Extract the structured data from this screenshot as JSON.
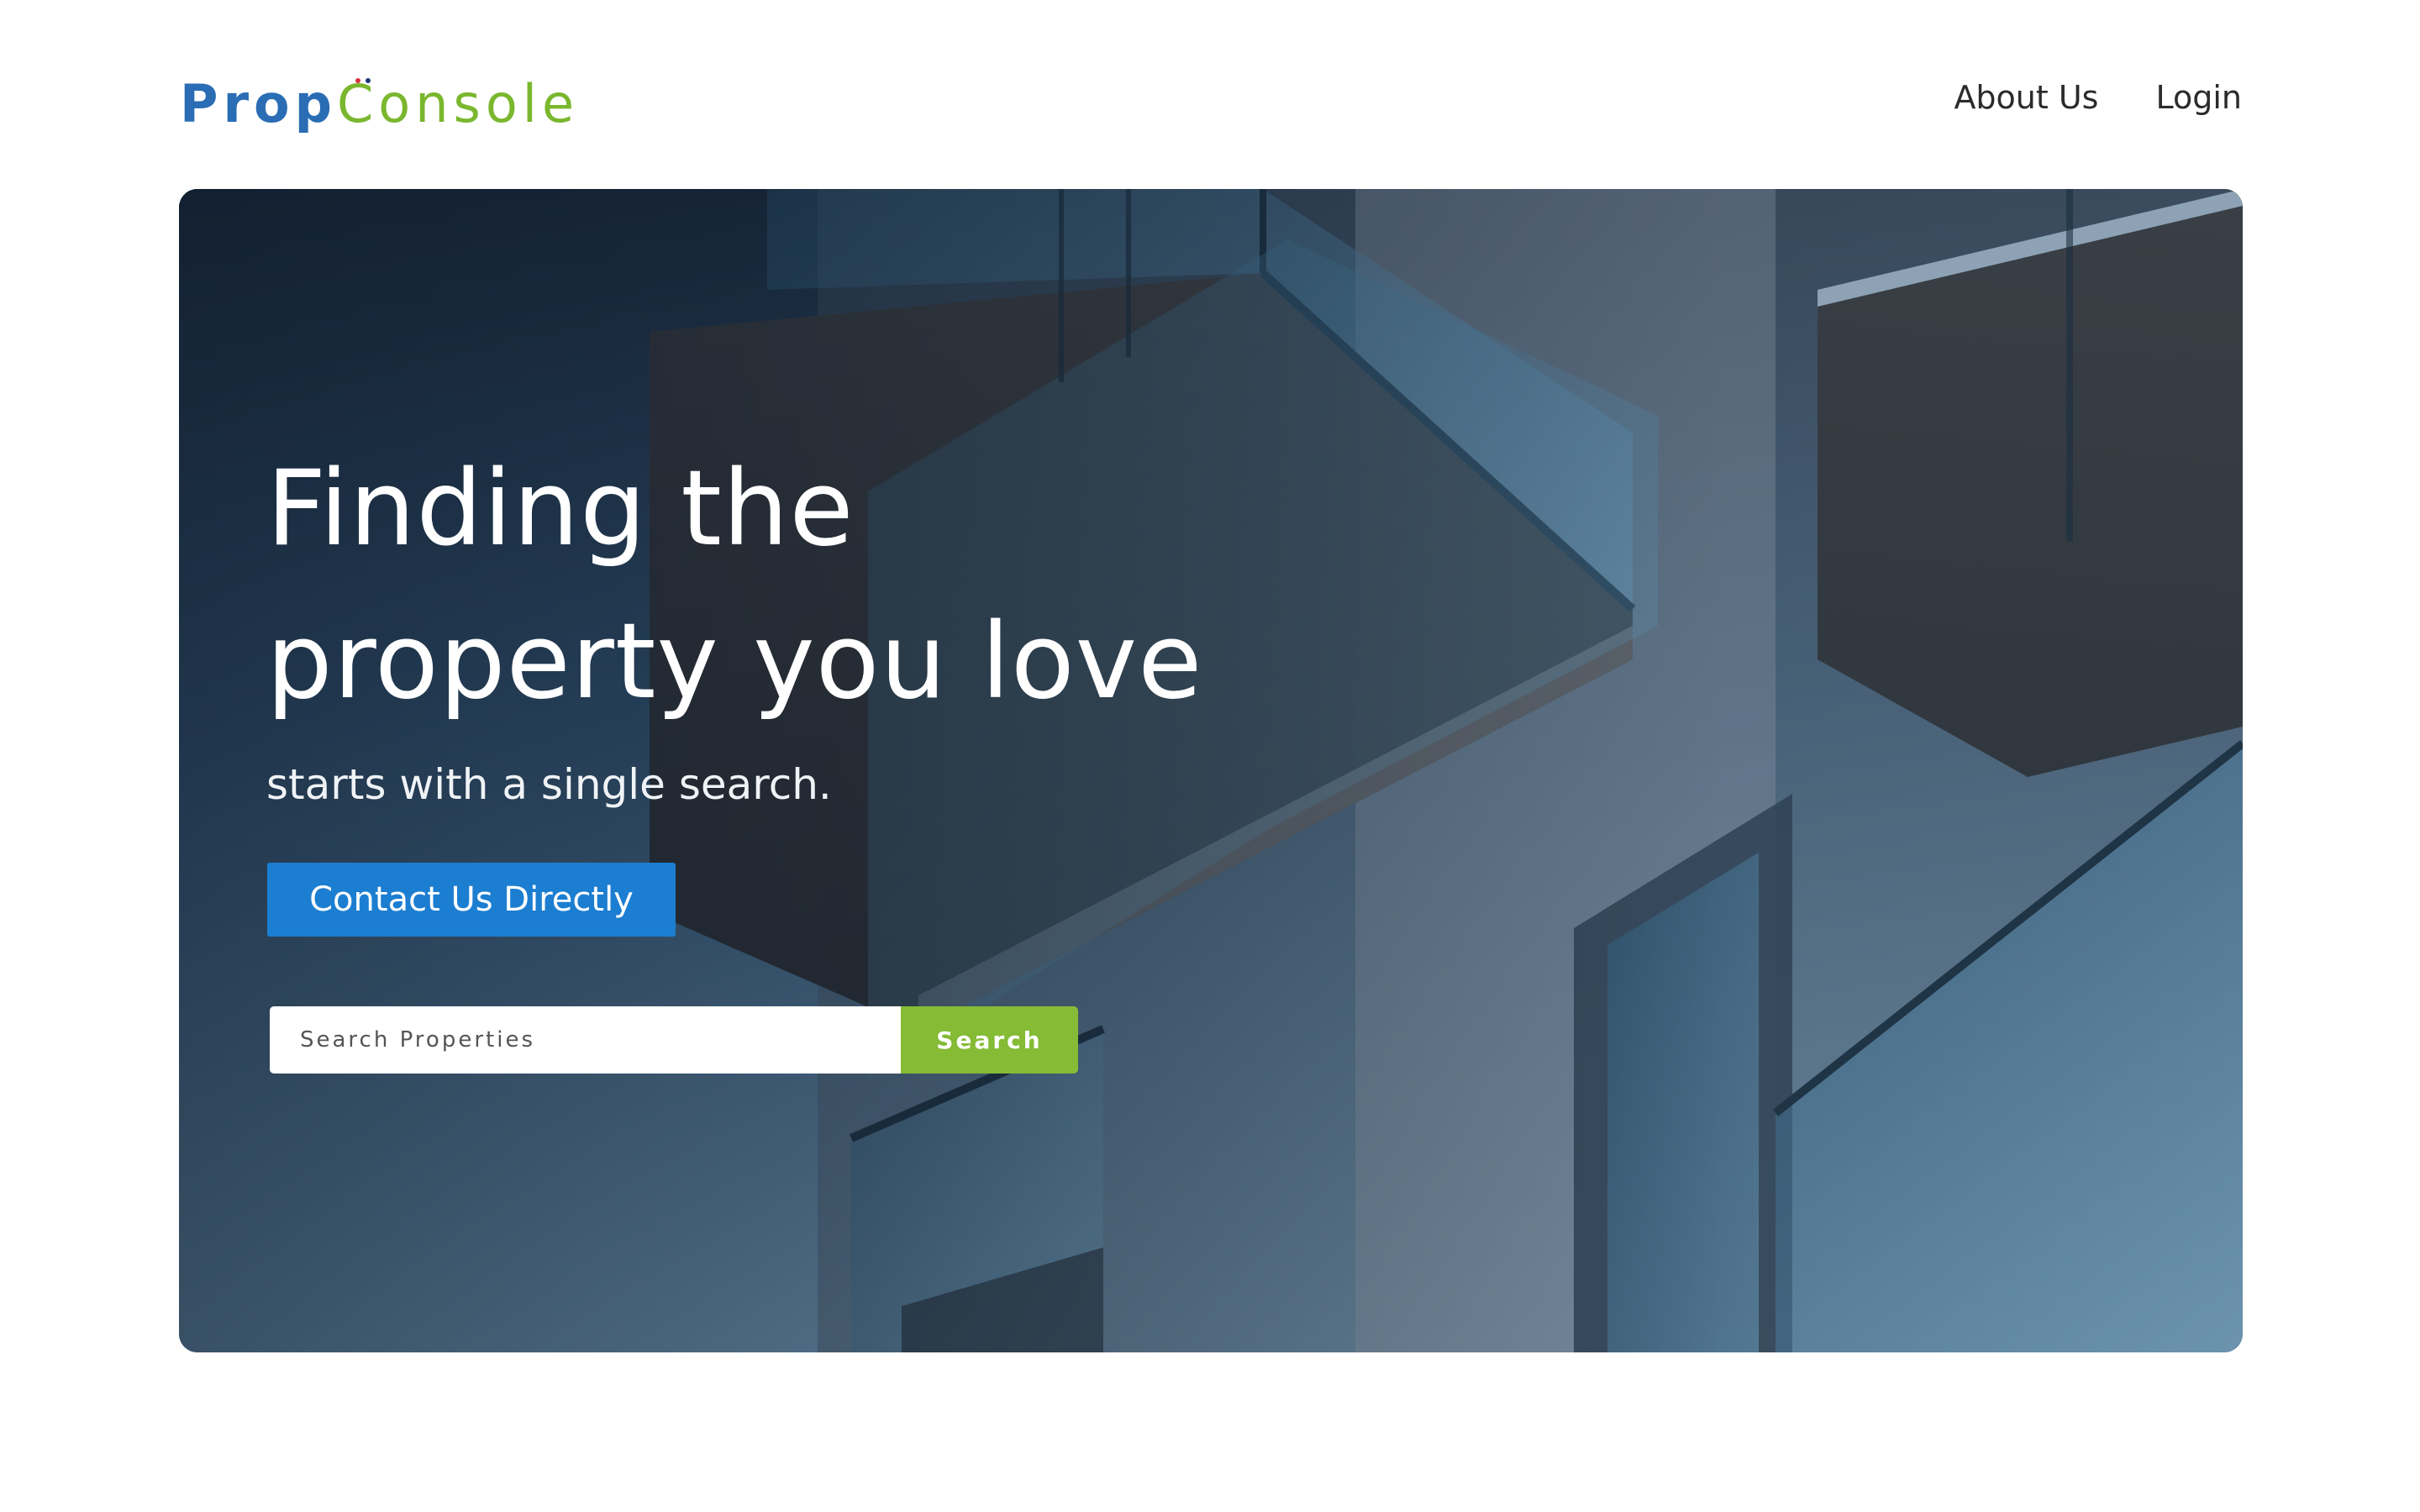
{
  "brand": {
    "name_part1": "Prop",
    "name_part2": "Console",
    "colors": {
      "primary_blue": "#2a6db5",
      "primary_green": "#7ab72e",
      "dot_red": "#d8343c",
      "dot_navy": "#1e3a78"
    }
  },
  "nav": {
    "items": [
      {
        "label": "About Us"
      },
      {
        "label": "Login"
      }
    ]
  },
  "hero": {
    "title_line1": "Finding the",
    "title_line2": "property you love",
    "subtitle": "starts with a single search.",
    "contact_button": "Contact Us Directly",
    "search": {
      "placeholder": "Search Properties",
      "value": "",
      "button_label": "Search"
    },
    "background_icon": "building-balconies-photo",
    "colors": {
      "button_blue": "#1c7ed1",
      "search_green": "#85bb35"
    }
  }
}
